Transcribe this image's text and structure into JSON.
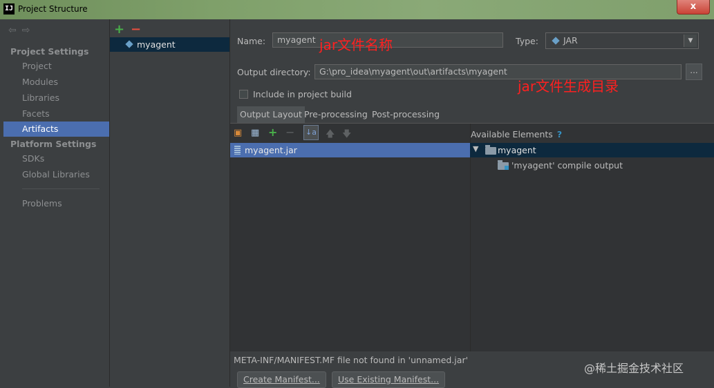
{
  "window": {
    "title": "Project Structure",
    "app_icon": "IJ",
    "close_glyph": "x"
  },
  "sidebar": {
    "project_settings_header": "Project Settings",
    "project_items": [
      {
        "label": "Project"
      },
      {
        "label": "Modules"
      },
      {
        "label": "Libraries"
      },
      {
        "label": "Facets"
      },
      {
        "label": "Artifacts",
        "selected": true
      }
    ],
    "platform_settings_header": "Platform Settings",
    "platform_items": [
      {
        "label": "SDKs"
      },
      {
        "label": "Global Libraries"
      }
    ],
    "problems_label": "Problems"
  },
  "artifacts_list": {
    "add_glyph": "+",
    "remove_glyph": "−",
    "items": [
      {
        "label": "myagent",
        "selected": true
      }
    ]
  },
  "editor": {
    "name_label": "Name:",
    "name_value": "myagent",
    "name_annotation": "jar文件名称",
    "type_label": "Type:",
    "type_value": "JAR",
    "output_dir_label": "Output directory:",
    "output_dir_value": "G:\\pro_idea\\myagent\\out\\artifacts\\myagent",
    "browse_glyph": "...",
    "output_dir_annotation": "jar文件生成目录",
    "include_build_label": "Include in project build",
    "include_build_checked": false,
    "tabs": [
      {
        "label": "Output Layout",
        "active": true
      },
      {
        "label": "Pre-processing"
      },
      {
        "label": "Post-processing"
      }
    ],
    "layout_root": "myagent.jar",
    "available_header": "Available Elements",
    "available_help_glyph": "?",
    "available_items": [
      {
        "label": "myagent",
        "expanded": true
      },
      {
        "label": "'myagent' compile output"
      }
    ],
    "manifest_message": "META-INF/MANIFEST.MF file not found in 'unnamed.jar'",
    "create_manifest_label": "Create Manifest...",
    "use_existing_manifest_label": "Use Existing Manifest..."
  },
  "watermark": "@稀土掘金技术社区",
  "colors": {
    "background": "#3c3f41",
    "selection": "#4b6eaf",
    "tree_selection": "#0d293e",
    "annotation": "#ff2020",
    "add": "#49b14a",
    "remove": "#e8503f"
  }
}
